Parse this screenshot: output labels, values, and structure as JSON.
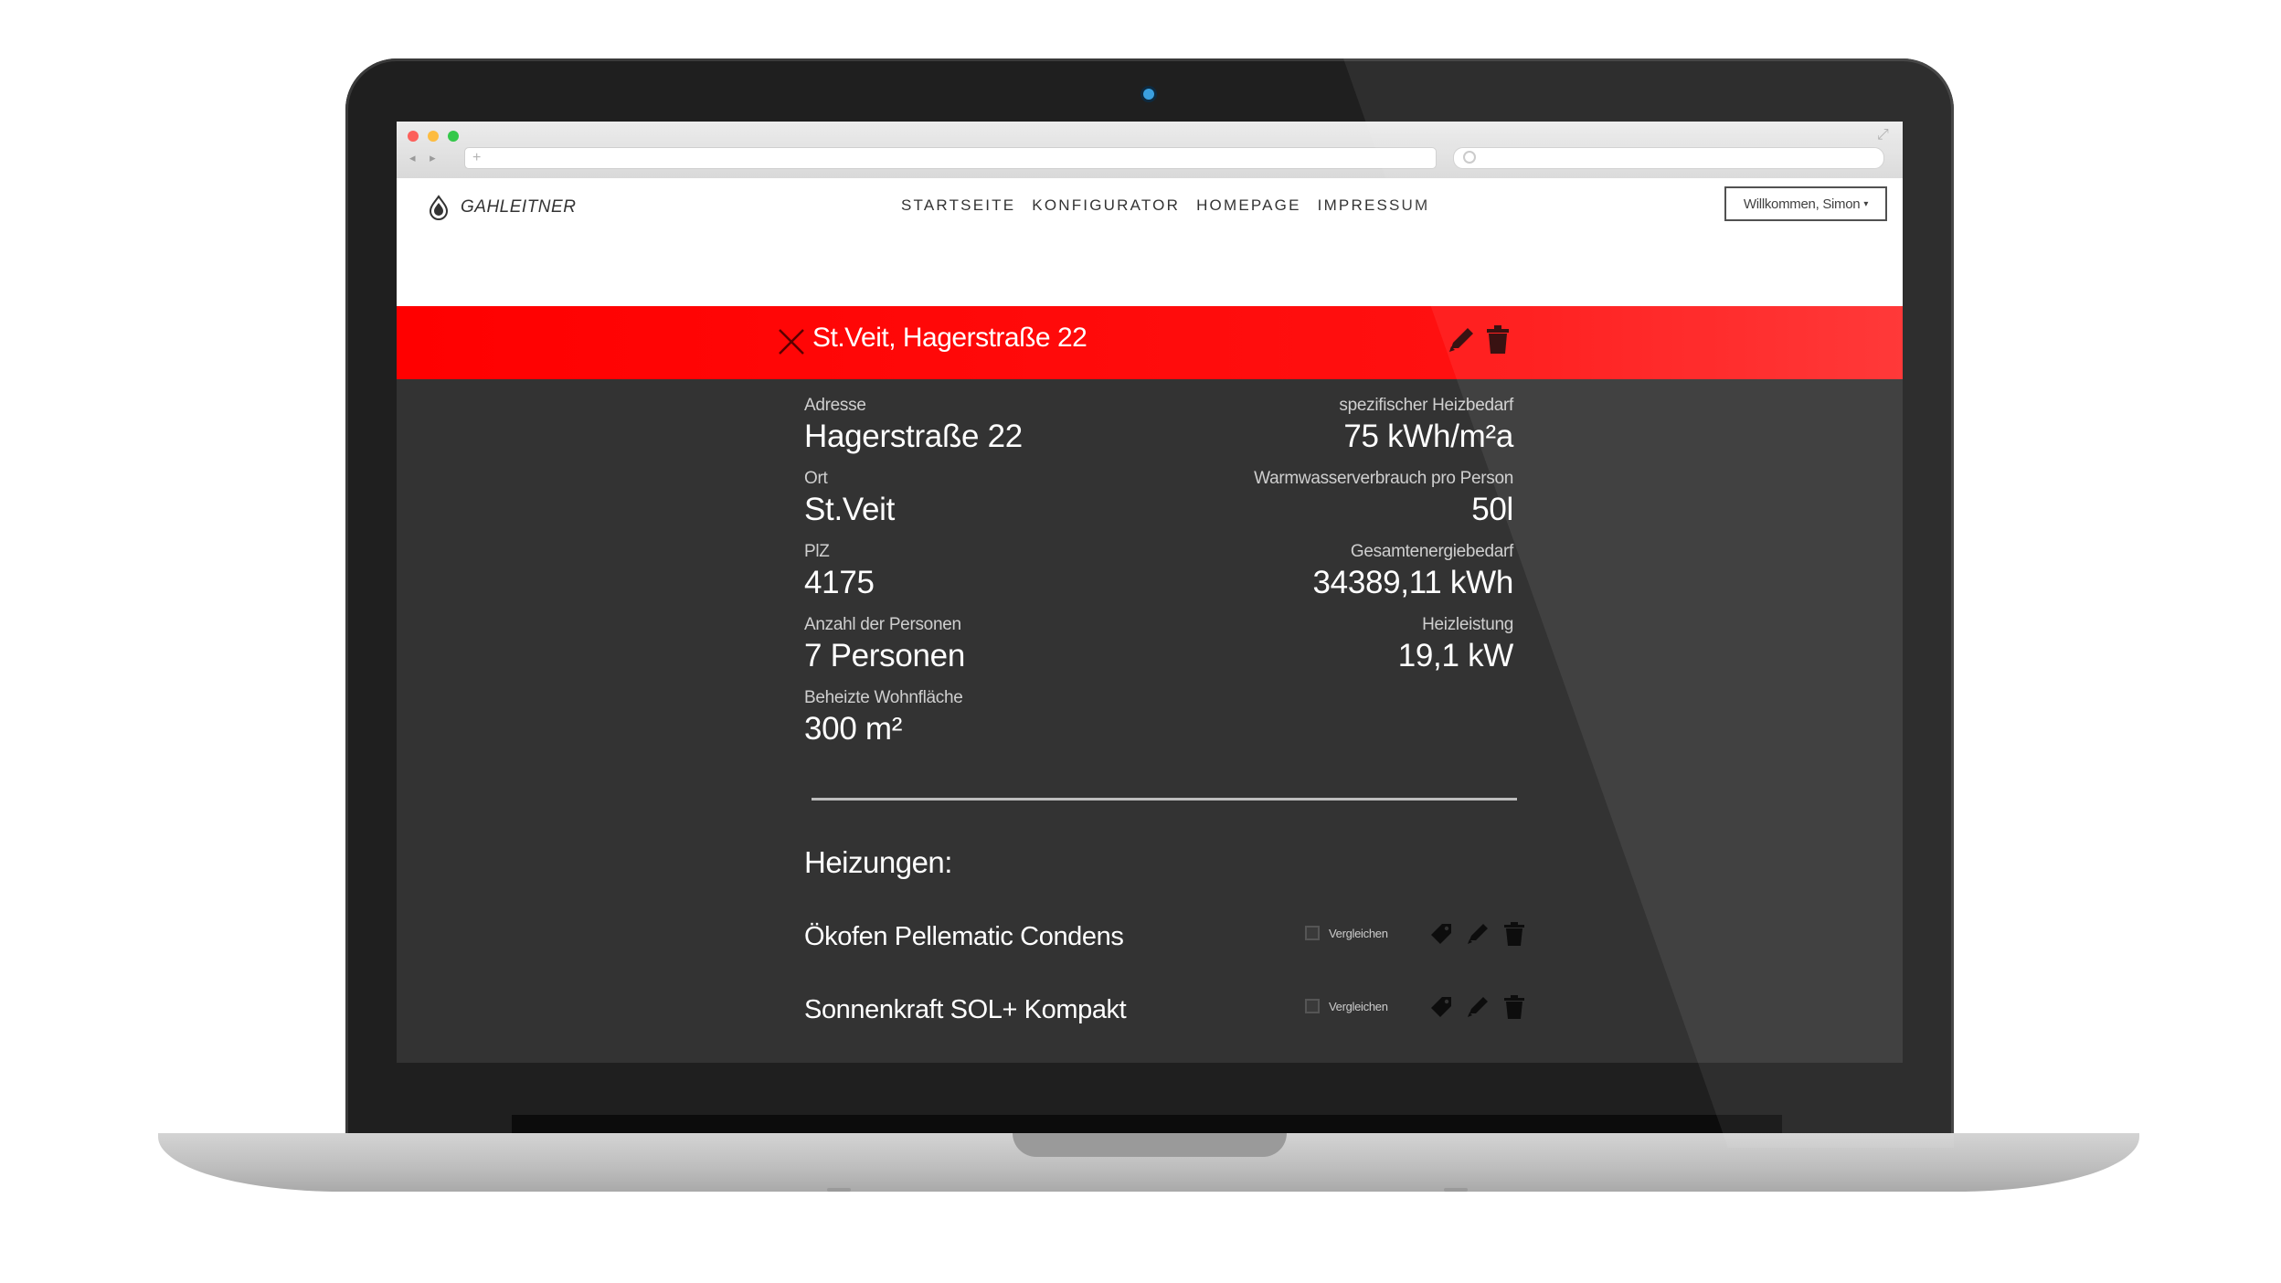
{
  "browser": {
    "url_placeholder": "+",
    "nav_arrows": "◂ ▸"
  },
  "header": {
    "logo_text": "GAHLEITNER",
    "nav": [
      "STARTSEITE",
      "KONFIGURATOR",
      "HOMEPAGE",
      "IMPRESSUM"
    ],
    "user_menu": "Willkommen, Simon",
    "user_caret": "▾"
  },
  "title_bar": {
    "title": "St.Veit, Hagerstraße 22"
  },
  "details": {
    "left": [
      {
        "label": "Adresse",
        "value": "Hagerstraße 22"
      },
      {
        "label": "Ort",
        "value": "St.Veit"
      },
      {
        "label": "PlZ",
        "value": "4175"
      },
      {
        "label": "Anzahl der Personen",
        "value": "7 Personen"
      },
      {
        "label": "Beheizte Wohnfläche",
        "value": "300 m²"
      }
    ],
    "right": [
      {
        "label": "spezifischer Heizbedarf",
        "value": "75 kWh/m²a"
      },
      {
        "label": "Warmwasserverbrauch pro Person",
        "value": "50l"
      },
      {
        "label": "Gesamtenergiebedarf",
        "value": "34389,11 kWh"
      },
      {
        "label": "Heizleistung",
        "value": "19,1 kW"
      }
    ]
  },
  "heizungen": {
    "title": "Heizungen:",
    "items": [
      {
        "name": "Ökofen Pellematic Condens",
        "compare_label": "Vergleichen"
      },
      {
        "name": "Sonnenkraft SOL+ Kompakt",
        "compare_label": "Vergleichen"
      }
    ]
  },
  "colors": {
    "accent": "#ff0000",
    "panel": "#333333",
    "header_bg": "#ffffff"
  },
  "icons": [
    "close-icon",
    "pencil-icon",
    "trash-icon",
    "tag-icon",
    "search-icon",
    "expand-icon",
    "logo-drop-icon"
  ]
}
